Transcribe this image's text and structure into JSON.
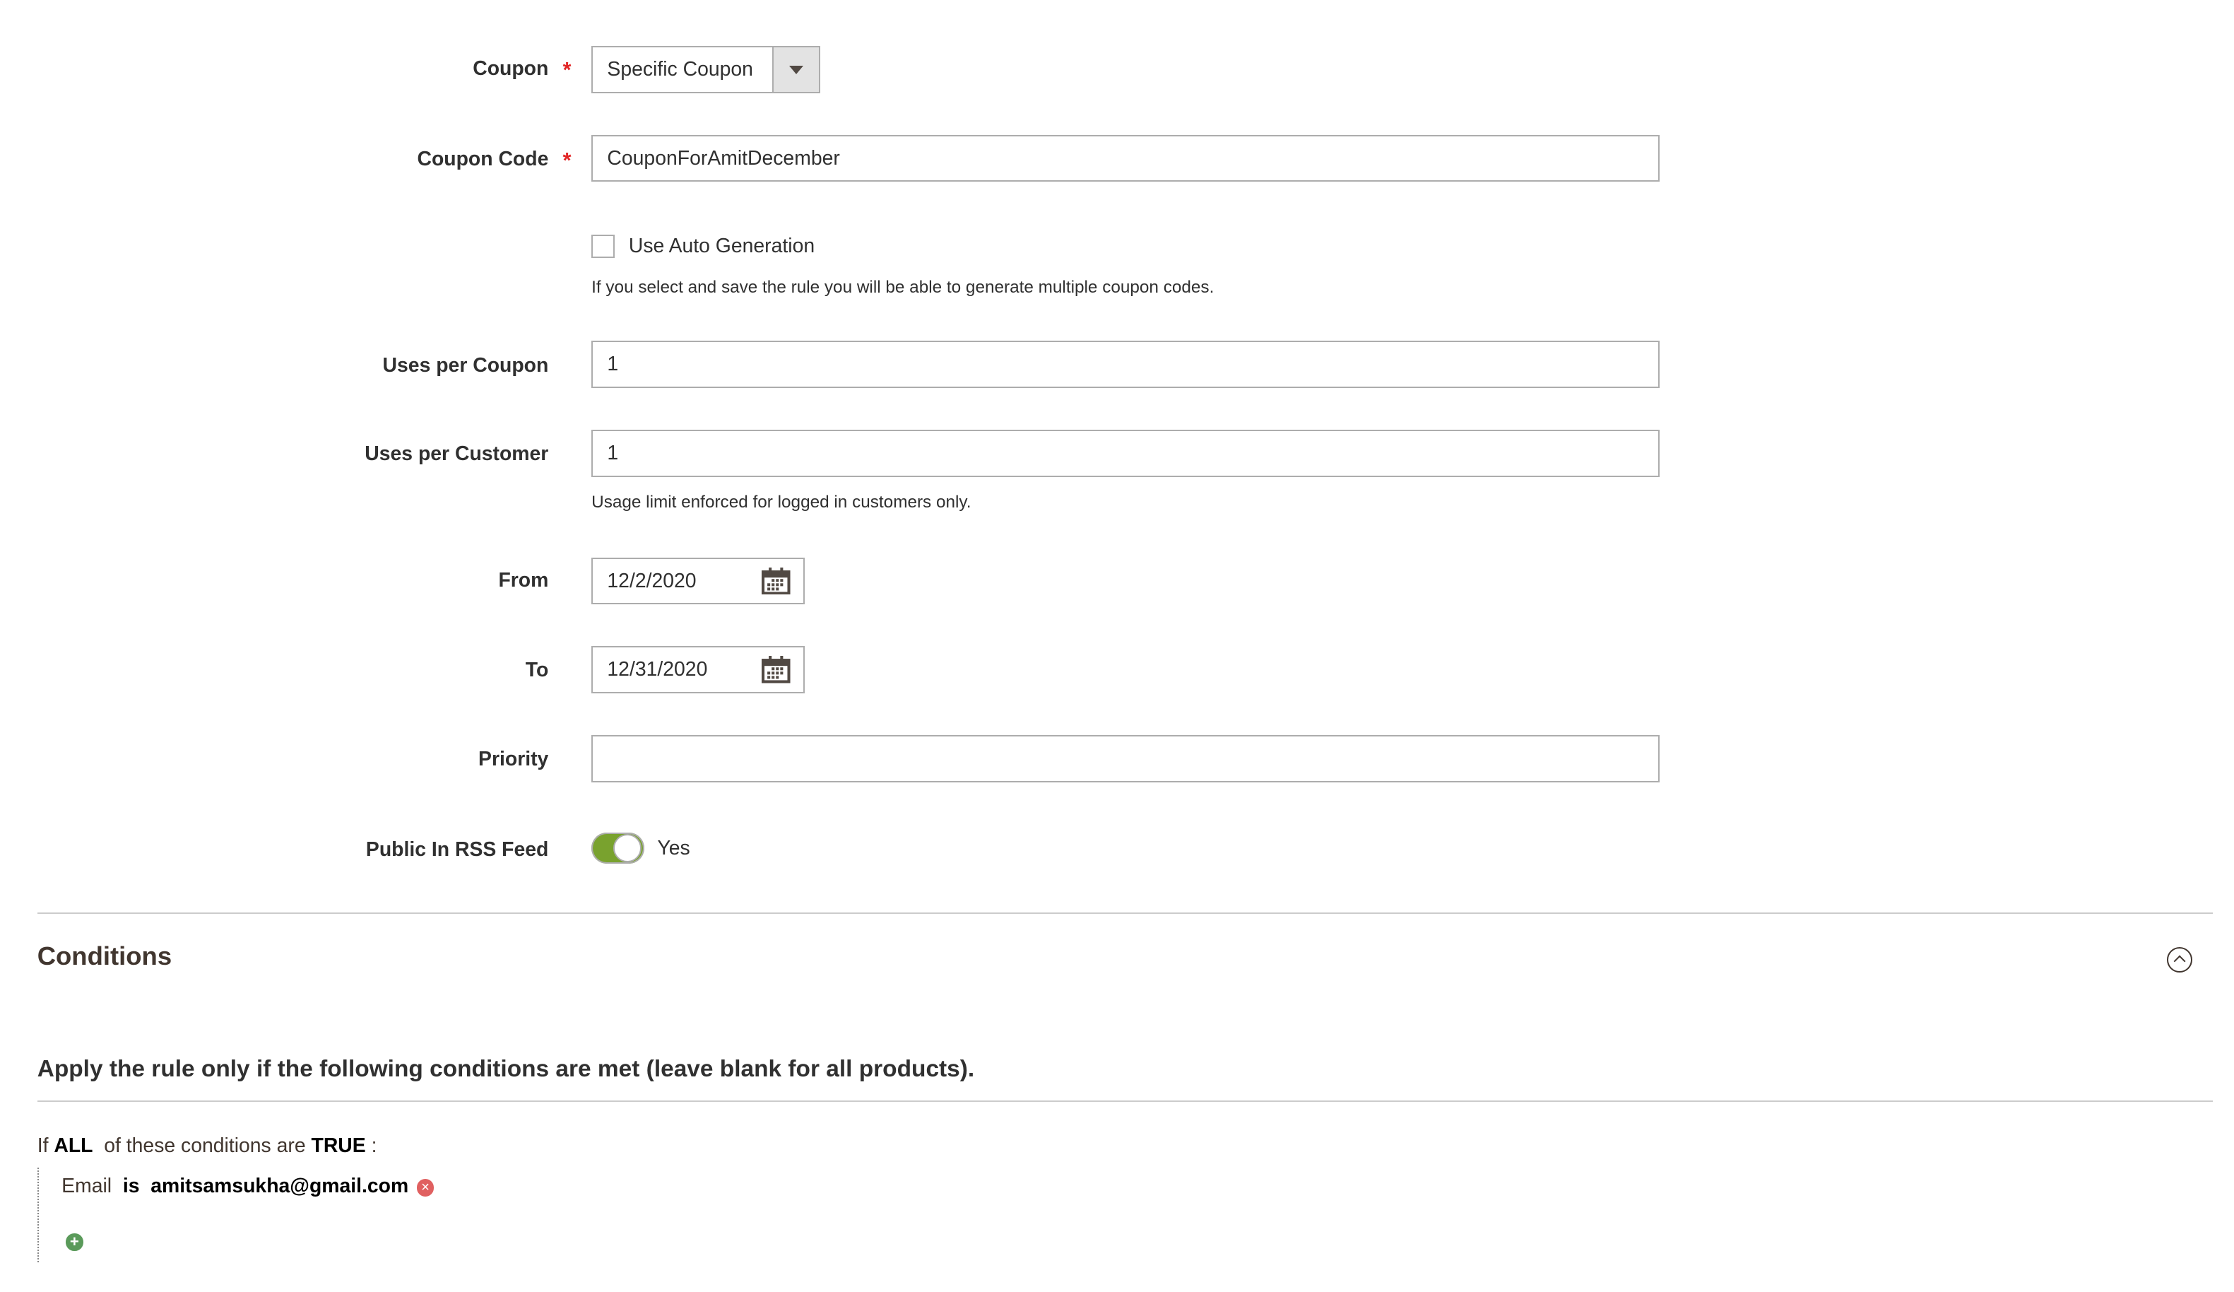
{
  "form": {
    "coupon": {
      "label": "Coupon",
      "value": "Specific Coupon"
    },
    "coupon_code": {
      "label": "Coupon Code",
      "value": "CouponForAmitDecember"
    },
    "auto_generation": {
      "label": "Use Auto Generation",
      "checked": false,
      "note": "If you select and save the rule you will be able to generate multiple coupon codes."
    },
    "uses_per_coupon": {
      "label": "Uses per Coupon",
      "value": "1"
    },
    "uses_per_customer": {
      "label": "Uses per Customer",
      "value": "1",
      "note": "Usage limit enforced for logged in customers only."
    },
    "from": {
      "label": "From",
      "value": "12/2/2020"
    },
    "to": {
      "label": "To",
      "value": "12/31/2020"
    },
    "priority": {
      "label": "Priority",
      "value": ""
    },
    "rss": {
      "label": "Public In RSS Feed",
      "value": "Yes",
      "on": true
    },
    "required_mark": "*"
  },
  "conditions": {
    "title": "Conditions",
    "heading": "Apply the rule only if the following conditions are met (leave blank for all products).",
    "if_text": "If",
    "aggregator": "ALL",
    "of_text": "of these conditions are",
    "value": "TRUE",
    "colon": ":",
    "rule": {
      "attribute": "Email",
      "operator": "is",
      "value": "amitsamsukha@gmail.com"
    }
  },
  "colors": {
    "toggle_on": "#79a22e",
    "required": "#e22626",
    "remove": "#e06060",
    "add": "#5a9a5a"
  }
}
